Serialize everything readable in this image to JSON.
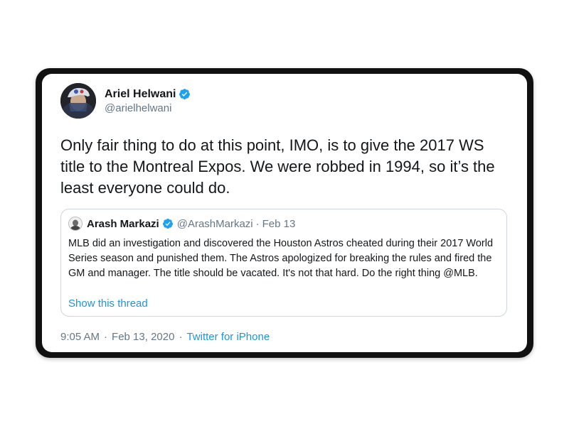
{
  "tweet": {
    "author": {
      "display_name": "Ariel Helwani",
      "handle": "@arielhelwani",
      "verified": true,
      "avatar_icon": "profile-photo"
    },
    "text": "Only fair thing to do at this point, IMO, is to give the 2017 WS title to the Montreal Expos. We were robbed in 1994, so it’s the least everyone could do.",
    "quoted": {
      "author": {
        "display_name": "Arash Markazi",
        "handle": "@ArashMarkazi",
        "verified": true
      },
      "separator": "·",
      "date": "Feb 13",
      "text": "MLB did an investigation and discovered the Houston Astros cheated during their 2017 World Series season and punished them. The Astros apologized for breaking the rules and fired the GM and manager. The title should be vacated. It's not that hard. Do the right thing @MLB.",
      "show_thread_label": "Show this thread"
    },
    "meta": {
      "time": "9:05 AM",
      "separator": "·",
      "date": "Feb 13, 2020",
      "source": "Twitter for iPhone"
    }
  },
  "colors": {
    "link": "#1b95e0",
    "verified_badge": "#1da1f2",
    "secondary_text": "#657786",
    "primary_text": "#14171a",
    "frame": "#111111"
  }
}
